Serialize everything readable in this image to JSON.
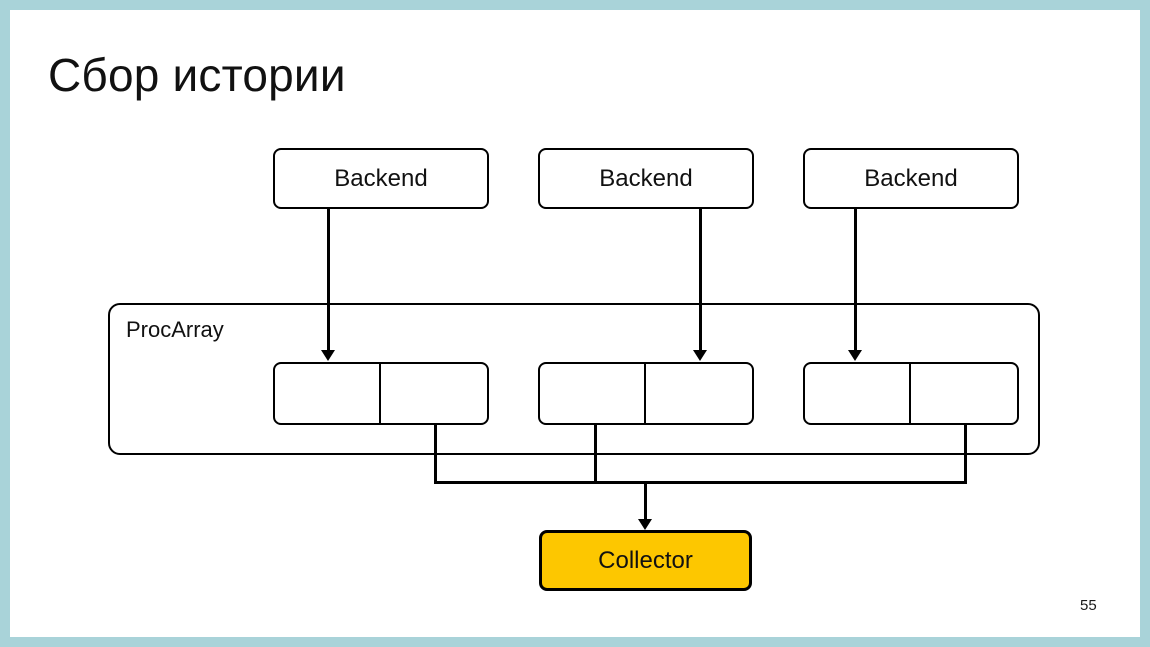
{
  "slide": {
    "title": "Сбор истории",
    "page_number": "55",
    "frame_color": "#a9d3d9",
    "background": "#ffffff"
  },
  "diagram": {
    "type": "flow",
    "backends": [
      {
        "label": "Backend"
      },
      {
        "label": "Backend"
      },
      {
        "label": "Backend"
      }
    ],
    "container": {
      "label": "ProcArray",
      "slots": [
        {
          "cells": [
            "",
            ""
          ]
        },
        {
          "cells": [
            "",
            ""
          ]
        },
        {
          "cells": [
            "",
            ""
          ]
        }
      ]
    },
    "collector": {
      "label": "Collector",
      "fill": "#fdc700",
      "stroke": "#000000"
    },
    "edges": [
      {
        "from": "backend-1",
        "to": "slot-1",
        "arrow": true
      },
      {
        "from": "backend-2",
        "to": "slot-2",
        "arrow": true
      },
      {
        "from": "backend-3",
        "to": "slot-3",
        "arrow": true
      },
      {
        "from": "slot-1",
        "to": "collector",
        "arrow": false
      },
      {
        "from": "slot-2",
        "to": "collector",
        "arrow": false
      },
      {
        "from": "slot-3",
        "to": "collector",
        "arrow": false
      },
      {
        "from": "bus",
        "to": "collector",
        "arrow": true
      }
    ]
  }
}
